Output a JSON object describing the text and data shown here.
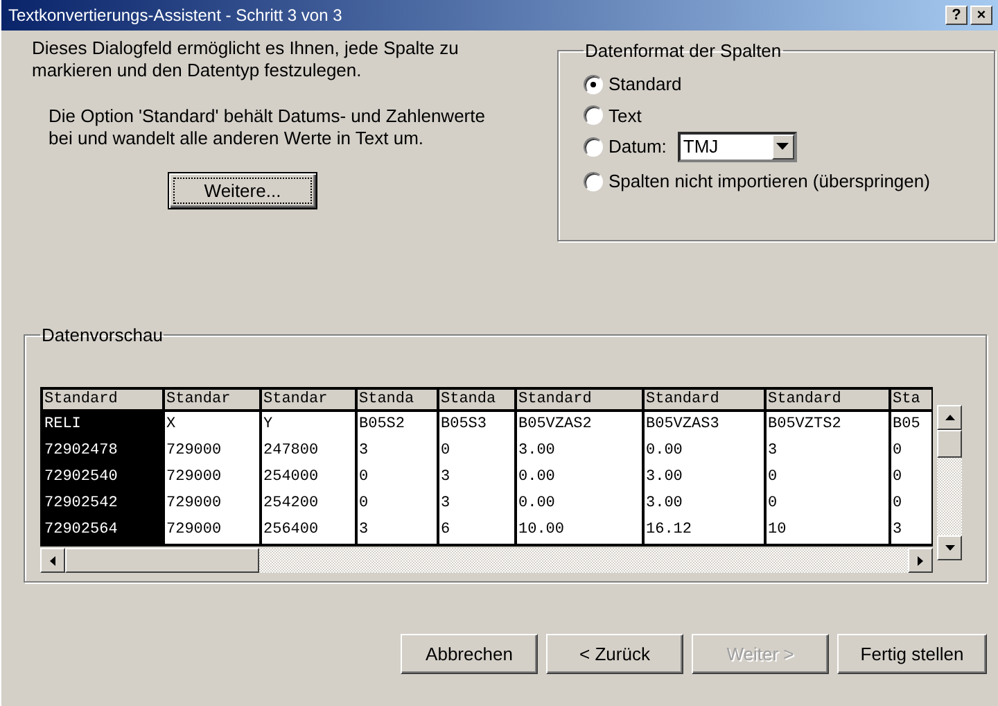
{
  "window": {
    "title": "Textkonvertierungs-Assistent - Schritt 3 von 3",
    "help_button": "?",
    "close_button": "×"
  },
  "intro": "Dieses Dialogfeld ermöglicht es Ihnen, jede Spalte zu markieren und den Datentyp festzulegen.",
  "note": "Die Option 'Standard' behält Datums- und Zahlenwerte bei und wandelt alle anderen Werte in Text um.",
  "more_button": "Weitere...",
  "format_group": {
    "title": "Datenformat der Spalten",
    "options": [
      {
        "label": "Standard",
        "kind": "plain",
        "selected": true
      },
      {
        "label": "Text",
        "kind": "plain",
        "selected": false
      },
      {
        "label": "Datum:",
        "kind": "date",
        "selected": false,
        "value": "TMJ"
      },
      {
        "label": "Spalten nicht importieren (überspringen)",
        "kind": "plain",
        "selected": false
      }
    ]
  },
  "preview": {
    "title": "Datenvorschau",
    "columns": [
      {
        "header": "Standard",
        "selected": true
      },
      {
        "header": "Standar",
        "selected": false
      },
      {
        "header": "Standar",
        "selected": false
      },
      {
        "header": "Standa",
        "selected": false
      },
      {
        "header": "Standa",
        "selected": false
      },
      {
        "header": "Standard",
        "selected": false
      },
      {
        "header": "Standard",
        "selected": false
      },
      {
        "header": "Standard",
        "selected": false
      },
      {
        "header": "Sta",
        "selected": false
      }
    ],
    "rows": [
      [
        "RELI",
        "X",
        "Y",
        "B05S2",
        "B05S3",
        "B05VZAS2",
        "B05VZAS3",
        "B05VZTS2",
        "B05"
      ],
      [
        "72902478",
        "729000",
        "247800",
        "3",
        "0",
        "3.00",
        "0.00",
        "3",
        "0"
      ],
      [
        "72902540",
        "729000",
        "254000",
        "0",
        "3",
        "0.00",
        "3.00",
        "0",
        "0"
      ],
      [
        "72902542",
        "729000",
        "254200",
        "0",
        "3",
        "0.00",
        "3.00",
        "0",
        "0"
      ],
      [
        "72902564",
        "729000",
        "256400",
        "3",
        "6",
        "10.00",
        "16.12",
        "10",
        "3"
      ]
    ]
  },
  "buttons": [
    {
      "label": "Abbrechen",
      "disabled": false
    },
    {
      "label": "< Zurück",
      "disabled": false
    },
    {
      "label": "Weiter >",
      "disabled": true
    },
    {
      "label": "Fertig stellen",
      "disabled": false
    }
  ]
}
